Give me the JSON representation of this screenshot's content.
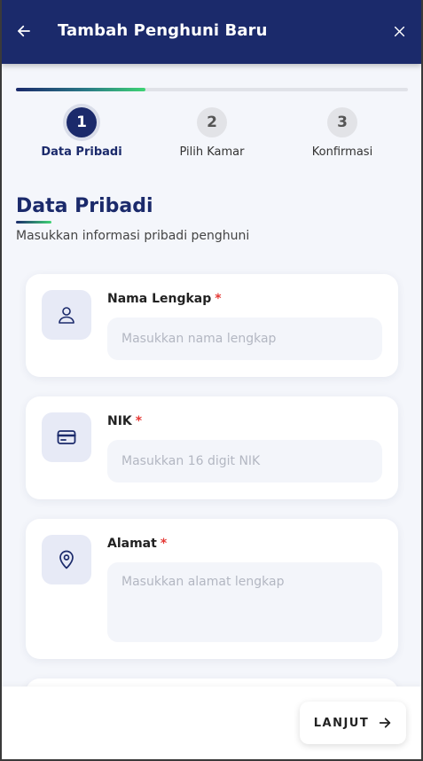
{
  "header": {
    "title": "Tambah Penghuni Baru",
    "back_icon": "arrow-left-icon",
    "close_icon": "close-icon"
  },
  "progress": {
    "current_step": 1,
    "total_steps": 3,
    "fraction": 0.33
  },
  "steps": [
    {
      "number": "1",
      "label": "Data Pribadi",
      "active": true
    },
    {
      "number": "2",
      "label": "Pilih Kamar",
      "active": false
    },
    {
      "number": "3",
      "label": "Konfirmasi",
      "active": false
    }
  ],
  "section": {
    "title": "Data Pribadi",
    "subtitle": "Masukkan informasi pribadi penghuni"
  },
  "fields": [
    {
      "label": "Nama Lengkap",
      "required_mark": "*",
      "placeholder": "Masukkan nama lengkap",
      "value": "",
      "icon": "user-icon"
    },
    {
      "label": "NIK",
      "required_mark": "*",
      "placeholder": "Masukkan 16 digit NIK",
      "value": "",
      "icon": "id-card-icon"
    },
    {
      "label": "Alamat",
      "required_mark": "*",
      "placeholder": "Masukkan alamat lengkap",
      "value": "",
      "icon": "map-pin-icon"
    }
  ],
  "footer": {
    "next_label": "LANJUT",
    "next_icon": "arrow-right-icon"
  },
  "colors": {
    "primary": "#1b2a6b",
    "accent": "#3ed474",
    "required": "#e53935",
    "background": "#f4f6fb"
  }
}
